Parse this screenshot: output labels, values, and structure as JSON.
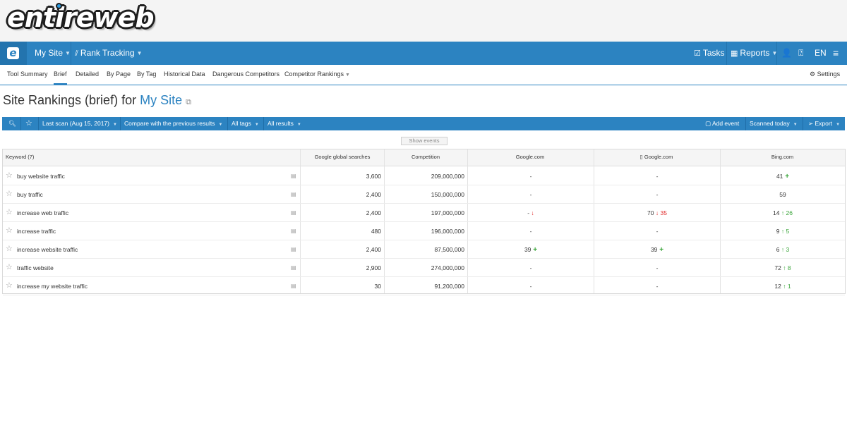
{
  "brand": {
    "logo_text": "entireweb",
    "icon_letter": "e"
  },
  "nav": {
    "site": "My Site",
    "tool": "Rank Tracking",
    "tasks": "Tasks",
    "reports": "Reports",
    "language": "EN"
  },
  "subnav": {
    "items": [
      "Tool Summary",
      "Brief",
      "Detailed",
      "By Page",
      "By Tag",
      "Historical Data",
      "Dangerous Competitors",
      "Competitor Rankings"
    ],
    "active": "Brief",
    "settings": "Settings"
  },
  "page": {
    "title_prefix": "Site Rankings (brief) for",
    "site_name": "My Site"
  },
  "toolbar": {
    "last_scan": "Last scan (Aug 15, 2017)",
    "compare": "Compare with the previous results",
    "tags": "All tags",
    "results": "All results",
    "add_event": "Add event",
    "scanned": "Scanned today",
    "export": "Export"
  },
  "show_events": "Show events",
  "table": {
    "headers": {
      "keyword": "Keyword (7)",
      "searches": "Google global searches",
      "competition": "Competition",
      "google": "Google.com",
      "google_mobile": "Google.com",
      "bing": "Bing.com"
    },
    "rows": [
      {
        "keyword": "buy website traffic",
        "searches": "3,600",
        "competition": "209,000,000",
        "google": {
          "rank": "-",
          "change": "",
          "dir": ""
        },
        "google_mobile": {
          "rank": "-",
          "change": "",
          "dir": ""
        },
        "bing": {
          "rank": "41",
          "change": "",
          "dir": "new"
        }
      },
      {
        "keyword": "buy traffic",
        "searches": "2,400",
        "competition": "150,000,000",
        "google": {
          "rank": "-",
          "change": "",
          "dir": ""
        },
        "google_mobile": {
          "rank": "-",
          "change": "",
          "dir": ""
        },
        "bing": {
          "rank": "59",
          "change": "",
          "dir": ""
        }
      },
      {
        "keyword": "increase web traffic",
        "searches": "2,400",
        "competition": "197,000,000",
        "google": {
          "rank": "-",
          "change": "",
          "dir": "down"
        },
        "google_mobile": {
          "rank": "70",
          "change": "35",
          "dir": "down"
        },
        "bing": {
          "rank": "14",
          "change": "26",
          "dir": "up"
        }
      },
      {
        "keyword": "increase traffic",
        "searches": "480",
        "competition": "196,000,000",
        "google": {
          "rank": "-",
          "change": "",
          "dir": ""
        },
        "google_mobile": {
          "rank": "-",
          "change": "",
          "dir": ""
        },
        "bing": {
          "rank": "9",
          "change": "5",
          "dir": "up"
        }
      },
      {
        "keyword": "increase website traffic",
        "searches": "2,400",
        "competition": "87,500,000",
        "google": {
          "rank": "39",
          "change": "",
          "dir": "new"
        },
        "google_mobile": {
          "rank": "39",
          "change": "",
          "dir": "new"
        },
        "bing": {
          "rank": "6",
          "change": "3",
          "dir": "up"
        }
      },
      {
        "keyword": "traffic website",
        "searches": "2,900",
        "competition": "274,000,000",
        "google": {
          "rank": "-",
          "change": "",
          "dir": ""
        },
        "google_mobile": {
          "rank": "-",
          "change": "",
          "dir": ""
        },
        "bing": {
          "rank": "72",
          "change": "8",
          "dir": "up"
        }
      },
      {
        "keyword": "increase my website traffic",
        "searches": "30",
        "competition": "91,200,000",
        "google": {
          "rank": "-",
          "change": "",
          "dir": ""
        },
        "google_mobile": {
          "rank": "-",
          "change": "",
          "dir": ""
        },
        "bing": {
          "rank": "12",
          "change": "1",
          "dir": "up"
        }
      }
    ]
  },
  "icons": {
    "search": "search-icon",
    "star": "star-icon",
    "note": "note-icon",
    "copy": "copy-icon",
    "settings": "gear-icon",
    "tasks": "tasks-icon",
    "reports": "reports-icon",
    "user": "user-icon",
    "help": "help-icon",
    "menu": "menu-icon",
    "export": "send-icon",
    "add_event": "flag-icon",
    "mobile": "mobile-icon",
    "chart": "chart-icon"
  },
  "colors": {
    "accent": "#2c83c1",
    "accent_dark": "#2374ae",
    "up": "#3aa53a",
    "down": "#e02b2b"
  }
}
